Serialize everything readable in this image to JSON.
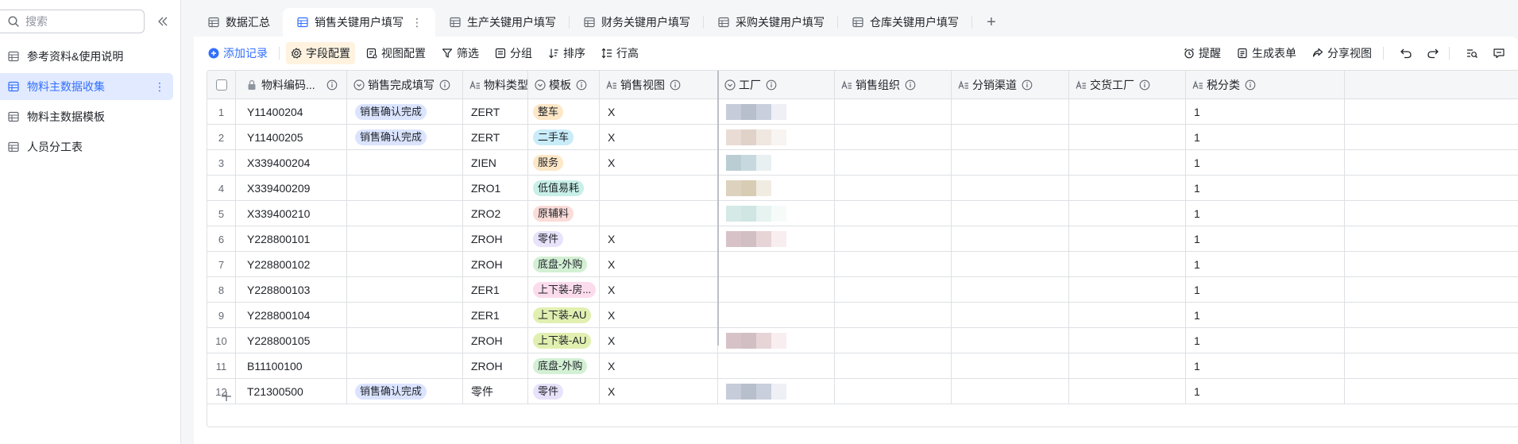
{
  "sidebar": {
    "search_placeholder": "搜索",
    "items": [
      {
        "label": "参考资料&使用说明",
        "active": false
      },
      {
        "label": "物料主数据收集",
        "active": true
      },
      {
        "label": "物料主数据模板",
        "active": false
      },
      {
        "label": "人员分工表",
        "active": false
      }
    ]
  },
  "tabs": [
    {
      "label": "数据汇总",
      "active": false
    },
    {
      "label": "销售关键用户填写",
      "active": true
    },
    {
      "label": "生产关键用户填写",
      "active": false
    },
    {
      "label": "财务关键用户填写",
      "active": false
    },
    {
      "label": "采购关键用户填写",
      "active": false
    },
    {
      "label": "仓库关键用户填写",
      "active": false
    }
  ],
  "toolbar": {
    "add_record": "添加记录",
    "field_config": "字段配置",
    "view_config": "视图配置",
    "filter": "筛选",
    "group": "分组",
    "sort": "排序",
    "row_height": "行高",
    "remind": "提醒",
    "generate_form": "生成表单",
    "share_view": "分享视图"
  },
  "columns": [
    {
      "label": "物料编码...",
      "type": "lock"
    },
    {
      "label": "销售完成填写",
      "type": "single-select"
    },
    {
      "label": "物料类型",
      "type": "text"
    },
    {
      "label": "模板",
      "type": "single-select"
    },
    {
      "label": "销售视图",
      "type": "text"
    },
    {
      "label": "工厂",
      "type": "single-select"
    },
    {
      "label": "销售组织",
      "type": "text"
    },
    {
      "label": "分销渠道",
      "type": "text"
    },
    {
      "label": "交货工厂",
      "type": "text"
    },
    {
      "label": "税分类",
      "type": "text"
    }
  ],
  "colors": {
    "accent": "#3370ff",
    "tag_sales_confirm": "#dbe4ff",
    "tag_orange": "#fde7c6",
    "tag_blue": "#c9ecf9",
    "tag_teal": "#c8efe8",
    "tag_red": "#fbdcd8",
    "tag_purple": "#e8e2fb",
    "tag_green": "#d3f0d4",
    "tag_pink": "#fbdcec",
    "tag_lime": "#e1f0b0"
  },
  "rows": [
    {
      "num": "1",
      "code": "Y11400204",
      "sales_done": "销售确认完成",
      "mat_type": "ZERT",
      "template": "整车",
      "template_color": "#fde7c6",
      "sales_view": "X",
      "tax": "1",
      "blur": [
        "#c6ccda",
        "#b8bfcc",
        "#c9cfdc",
        "#eef0f5"
      ]
    },
    {
      "num": "2",
      "code": "Y11400205",
      "sales_done": "销售确认完成",
      "mat_type": "ZERT",
      "template": "二手车",
      "template_color": "#c9ecf9",
      "sales_view": "X",
      "tax": "1",
      "blur": [
        "#e8dcd4",
        "#e0d2c9",
        "#efe7e0",
        "#f8f4f1"
      ]
    },
    {
      "num": "3",
      "code": "X339400204",
      "sales_done": "",
      "mat_type": "ZIEN",
      "template": "服务",
      "template_color": "#fde7c6",
      "sales_view": "X",
      "tax": "1",
      "blur": [
        "#b9cdd3",
        "#c7d9df",
        "#e9f0f2",
        "#ffffff"
      ]
    },
    {
      "num": "4",
      "code": "X339400209",
      "sales_done": "",
      "mat_type": "ZRO1",
      "template": "低值易耗",
      "template_color": "#c8efe8",
      "sales_view": "",
      "tax": "1",
      "blur": [
        "#ddd2bd",
        "#d8ccb4",
        "#f1ece2",
        "#ffffff"
      ]
    },
    {
      "num": "5",
      "code": "X339400210",
      "sales_done": "",
      "mat_type": "ZRO2",
      "template": "原辅料",
      "template_color": "#fbdcd8",
      "sales_view": "",
      "tax": "1",
      "blur": [
        "#d5e9e6",
        "#cfe6e3",
        "#e6f3f1",
        "#f6fbfa"
      ]
    },
    {
      "num": "6",
      "code": "Y228800101",
      "sales_done": "",
      "mat_type": "ZROH",
      "template": "零件",
      "template_color": "#e8e2fb",
      "sales_view": "X",
      "tax": "1",
      "blur": [
        "#d7c3c7",
        "#d2bfc3",
        "#e6d4d7",
        "#f8eef0"
      ]
    },
    {
      "num": "7",
      "code": "Y228800102",
      "sales_done": "",
      "mat_type": "ZROH",
      "template": "底盘-外购",
      "template_color": "#d3f0d4",
      "sales_view": "X",
      "tax": "1",
      "blur": [
        "#ffffff",
        "#ffffff",
        "#ffffff",
        "#ffffff"
      ]
    },
    {
      "num": "8",
      "code": "Y228800103",
      "sales_done": "",
      "mat_type": "ZER1",
      "template": "上下装-房...",
      "template_color": "#fbdcec",
      "sales_view": "X",
      "tax": "1",
      "blur": [
        "#ffffff",
        "#ffffff",
        "#ffffff",
        "#ffffff"
      ]
    },
    {
      "num": "9",
      "code": "Y228800104",
      "sales_done": "",
      "mat_type": "ZER1",
      "template": "上下装-AU",
      "template_color": "#e1f0b0",
      "sales_view": "X",
      "tax": "1",
      "blur": [
        "#ffffff",
        "#ffffff",
        "#ffffff",
        "#ffffff"
      ]
    },
    {
      "num": "10",
      "code": "Y228800105",
      "sales_done": "",
      "mat_type": "ZROH",
      "template": "上下装-AU",
      "template_color": "#e1f0b0",
      "sales_view": "X",
      "tax": "1",
      "blur": [
        "#d7c3c7",
        "#d2bfc3",
        "#e6d4d7",
        "#f8eef0"
      ]
    },
    {
      "num": "11",
      "code": "B11100100",
      "sales_done": "",
      "mat_type": "ZROH",
      "template": "底盘-外购",
      "template_color": "#d3f0d4",
      "sales_view": "X",
      "tax": "1",
      "blur": [
        "#ffffff",
        "#ffffff",
        "#ffffff",
        "#ffffff"
      ]
    },
    {
      "num": "12",
      "code": "T21300500",
      "sales_done": "销售确认完成",
      "mat_type": "零件",
      "template": "零件",
      "template_color": "#e8e2fb",
      "sales_view": "X",
      "tax": "1",
      "blur": [
        "#c6ccda",
        "#b8bfcc",
        "#c9cfdc",
        "#eef0f5"
      ]
    }
  ]
}
